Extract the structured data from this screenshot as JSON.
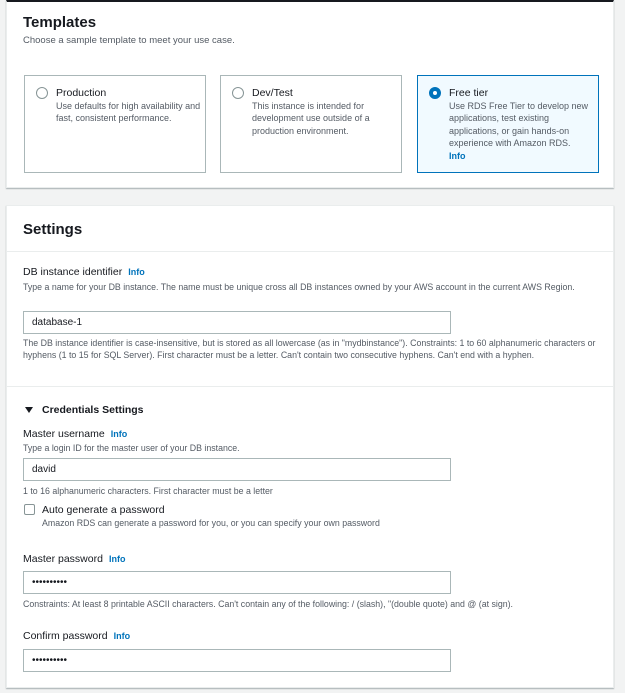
{
  "templates": {
    "title": "Templates",
    "subtitle": "Choose a sample template to meet your use case.",
    "options": [
      {
        "title": "Production",
        "description": "Use defaults for high availability and fast, consistent performance.",
        "selected": false
      },
      {
        "title": "Dev/Test",
        "description": "This instance is intended for development use outside of a production environment.",
        "selected": false
      },
      {
        "title": "Free tier",
        "description": "Use RDS Free Tier to develop new applications, test existing applications, or gain hands-on experience with Amazon RDS.",
        "info": "Info",
        "selected": true
      }
    ]
  },
  "settings": {
    "title": "Settings",
    "db_identifier": {
      "label": "DB instance identifier",
      "info": "Info",
      "description": "Type a name for your DB instance. The name must be unique cross all DB instances owned by your AWS account in the current AWS Region.",
      "value": "database-1",
      "constraint": "The DB instance identifier is case-insensitive, but is stored as all lowercase (as in \"mydbinstance\"). Constraints: 1 to 60 alphanumeric characters or hyphens (1 to 15 for SQL Server). First character must be a letter. Can't contain two consecutive hyphens. Can't end with a hyphen."
    },
    "credentials": {
      "section_title": "Credentials Settings",
      "username": {
        "label": "Master username",
        "info": "Info",
        "description": "Type a login ID for the master user of your DB instance.",
        "value": "david",
        "constraint": "1 to 16 alphanumeric characters. First character must be a letter"
      },
      "auto_generate": {
        "label": "Auto generate a password",
        "description": "Amazon RDS can generate a password for you, or you can specify your own password",
        "checked": false
      },
      "password": {
        "label": "Master password",
        "info": "Info",
        "value": "••••••••••",
        "constraint": "Constraints: At least 8 printable ASCII characters. Can't contain any of the following: / (slash), \"(double quote) and @ (at sign)."
      },
      "confirm_password": {
        "label": "Confirm password",
        "info": "Info",
        "value": "••••••••••"
      }
    }
  },
  "colors": {
    "accent": "#0073bb",
    "selected_bg": "#f1faff",
    "page_bg": "#f2f3f3"
  }
}
